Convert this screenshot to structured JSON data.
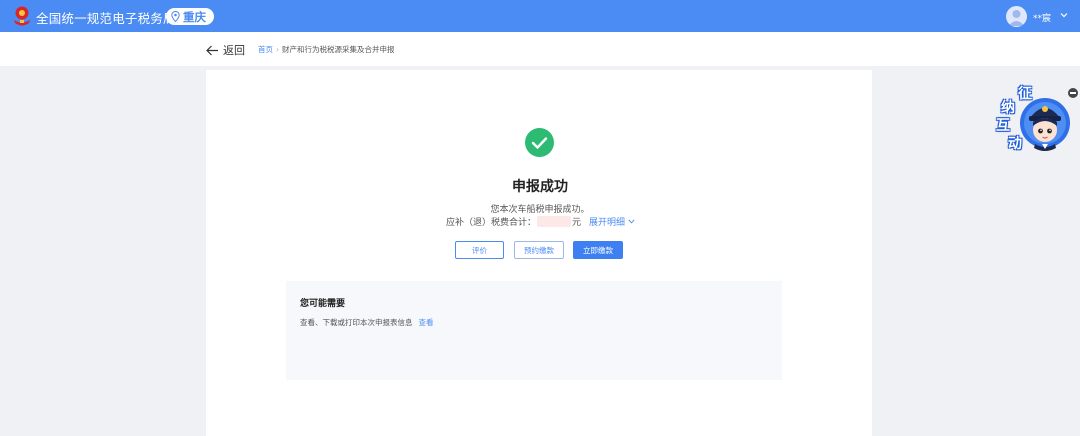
{
  "header": {
    "site_title": "全国统一规范电子税务局",
    "region": "重庆",
    "user_name": "**宸"
  },
  "breadcrumb": {
    "back_label": "返回",
    "home": "首页",
    "current": "财产和行为税税源采集及合并申报"
  },
  "result": {
    "title": "申报成功",
    "message": "您本次车船税申报成功。",
    "tax_label": "应补（退）税费合计：",
    "tax_unit": "元",
    "expand_label": "展开明细"
  },
  "actions": {
    "evaluate": "评价",
    "reserve_pay": "预约缴款",
    "pay_now": "立即缴款"
  },
  "needs": {
    "title": "您可能需要",
    "item_text": "查看、下载或打印本次申报表信息",
    "item_link": "查看"
  },
  "mascot": {
    "chars": [
      "征",
      "纳",
      "互",
      "动"
    ]
  },
  "colors": {
    "brand": "#4b8bf4",
    "success": "#2dbb73",
    "primary_button": "#3e80f2"
  }
}
